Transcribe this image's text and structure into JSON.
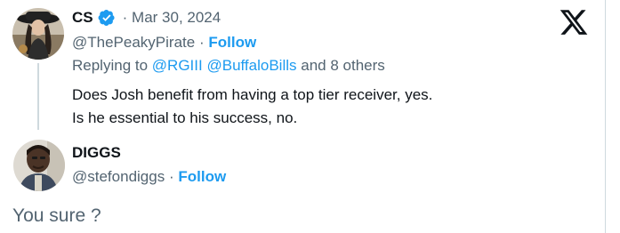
{
  "original_tweet": {
    "name": "CS",
    "date": "Mar 30, 2024",
    "handle": "@ThePeakyPirate",
    "separator": "·",
    "follow_label": "Follow",
    "replying_prefix": "Replying to",
    "mention_1": "@RGIII",
    "mention_2": "@BuffaloBills",
    "replying_suffix": "and 8 others",
    "text_line_1": "Does Josh benefit from having a top tier receiver, yes.",
    "text_line_2": "Is he essential to his success, no."
  },
  "reply_author": {
    "name": "DIGGS",
    "handle": "@stefondiggs",
    "separator": "·",
    "follow_label": "Follow"
  },
  "reply_box": {
    "value": "You sure ?"
  },
  "icons": {
    "verified": "verified-badge-icon",
    "close": "x-logo-icon"
  },
  "colors": {
    "accent": "#1d9bf0",
    "secondary_text": "#536471",
    "primary_text": "#0f1419"
  }
}
